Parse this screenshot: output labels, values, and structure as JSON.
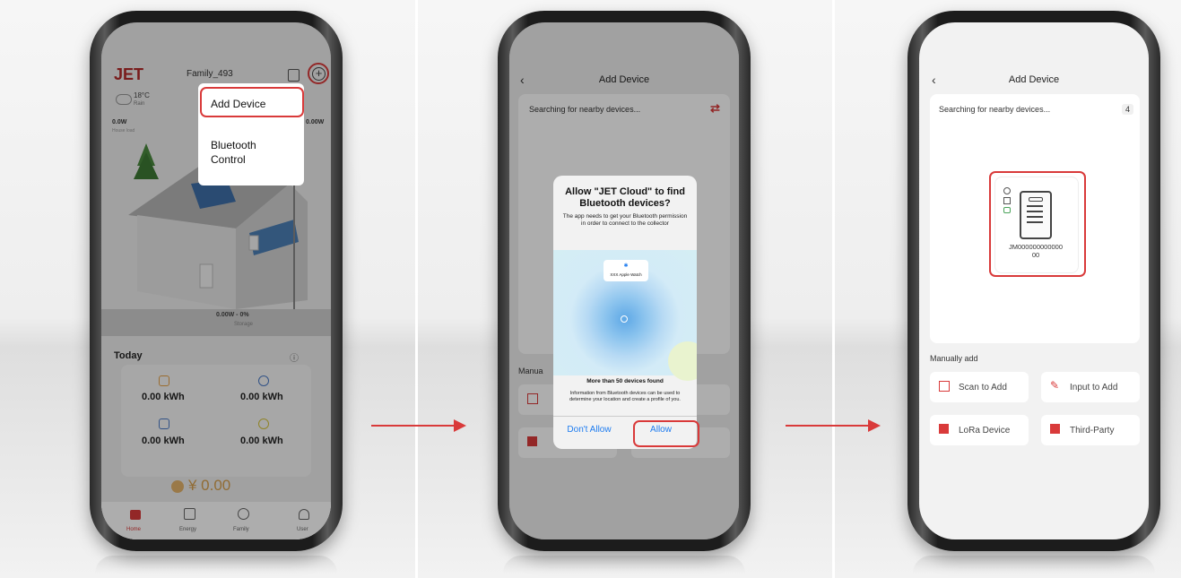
{
  "screen1": {
    "logo": "JET",
    "family": "Family_493",
    "weather_temp": "18°C",
    "weather_desc": "Rain",
    "power_left": "0.0W",
    "power_left_sub": "House load",
    "power_right": "0.00W",
    "storage_value": "0.00W - 0%",
    "storage_label": "Storage",
    "today_label": "Today",
    "stats": [
      "0.00 kWh",
      "0.00 kWh",
      "0.00 kWh",
      "0.00 kWh"
    ],
    "money": "¥ 0.00",
    "menu": {
      "add_device": "Add Device",
      "bluetooth": "Bluetooth\nControl"
    },
    "tabs": [
      "Home",
      "Energy",
      "Family",
      "User"
    ]
  },
  "screen2": {
    "title": "Add Device",
    "searching": "Searching for nearby devices...",
    "manual_partial": "Manua",
    "dialog": {
      "title": "Allow \"JET Cloud\" to find Bluetooth devices?",
      "message": "The app needs to get your Bluetooth permission in order to connect to the collector",
      "watch_label": "XXX Apple Watch",
      "found": "More than 50 devices found",
      "info": "Information from Bluetooth devices can be used to determine your location and create a profile of you.",
      "deny": "Don't Allow",
      "allow": "Allow"
    }
  },
  "screen3": {
    "title": "Add Device",
    "searching": "Searching for nearby devices...",
    "count": "4",
    "device_id": "JM000000000000\n00",
    "manual_label": "Manually add",
    "buttons": [
      "Scan to Add",
      "Input to Add",
      "LoRa Device",
      "Third-Party"
    ]
  },
  "colors": {
    "accent": "#d93a3a",
    "ios_blue": "#1e7cf0"
  }
}
